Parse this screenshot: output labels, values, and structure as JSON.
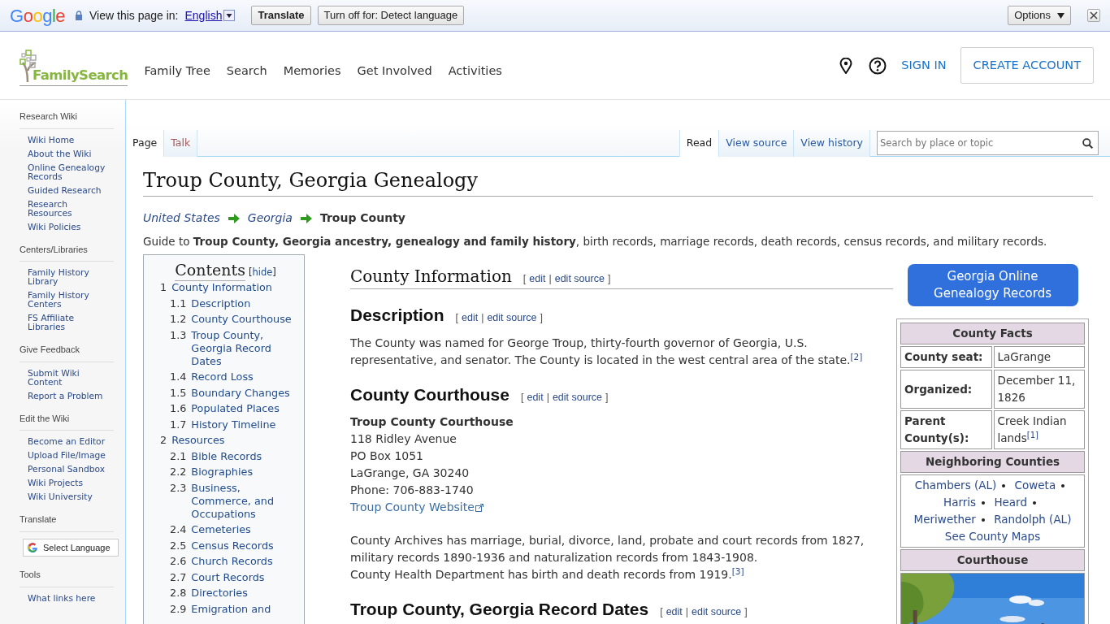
{
  "translate_bar": {
    "logo": "Google",
    "prompt": "View this page in:",
    "language": "English",
    "translate": "Translate",
    "turn_off": "Turn off for: Detect language",
    "options": "Options"
  },
  "header": {
    "logo_text": "FamilySearch",
    "nav": [
      "Family Tree",
      "Search",
      "Memories",
      "Get Involved",
      "Activities"
    ],
    "sign_in": "SIGN IN",
    "create_account": "CREATE ACCOUNT"
  },
  "sidebar": {
    "sections": [
      {
        "heading": "Research Wiki",
        "items": [
          "Wiki Home",
          "About the Wiki",
          "Online Genealogy Records",
          "Guided Research",
          "Research Resources",
          "Wiki Policies"
        ]
      },
      {
        "heading": "Centers/Libraries",
        "items": [
          "Family History Library",
          "Family History Centers",
          "FS Affiliate Libraries"
        ]
      },
      {
        "heading": "Give Feedback",
        "items": [
          "Submit Wiki Content",
          "Report a Problem"
        ]
      },
      {
        "heading": "Edit the Wiki",
        "items": [
          "Become an Editor",
          "Upload File/Image",
          "Personal Sandbox",
          "Wiki Projects",
          "Wiki University"
        ]
      },
      {
        "heading": "Translate",
        "widget": "Select Language"
      },
      {
        "heading": "Tools",
        "items": [
          "What links here"
        ]
      }
    ]
  },
  "page_tabs": {
    "left": [
      {
        "label": "Page",
        "selected": true
      },
      {
        "label": "Talk",
        "selected": false
      }
    ],
    "right": [
      {
        "label": "Read",
        "selected": true
      },
      {
        "label": "View source",
        "selected": false
      },
      {
        "label": "View history",
        "selected": false
      }
    ],
    "search": {
      "placeholder": "Search by place or topic"
    }
  },
  "title": "Troup County, Georgia Genealogy",
  "breadcrumb": [
    {
      "label": "United States",
      "kind": "link"
    },
    {
      "label": "Georgia",
      "kind": "link"
    },
    {
      "label": "Troup County",
      "kind": "current"
    }
  ],
  "intro": "Guide to **Troup County, Georgia ancestry, genealogy and family history**, birth records, marriage records, death records, census records, and military records.",
  "toc": {
    "title": "Contents",
    "hide": {
      "open": "[",
      "label": "hide",
      "close": "]"
    },
    "items": [
      {
        "number": "1",
        "label": "County Information",
        "children": [
          {
            "number": "1.1",
            "label": "Description"
          },
          {
            "number": "1.2",
            "label": "County Courthouse"
          },
          {
            "number": "1.3",
            "label": "Troup County, Georgia Record Dates"
          },
          {
            "number": "1.4",
            "label": "Record Loss"
          },
          {
            "number": "1.5",
            "label": "Boundary Changes"
          },
          {
            "number": "1.6",
            "label": "Populated Places"
          },
          {
            "number": "1.7",
            "label": "History Timeline"
          }
        ]
      },
      {
        "number": "2",
        "label": "Resources",
        "children": [
          {
            "number": "2.1",
            "label": "Bible Records"
          },
          {
            "number": "2.2",
            "label": "Biographies"
          },
          {
            "number": "2.3",
            "label": "Business, Commerce, and Occupations"
          },
          {
            "number": "2.4",
            "label": "Cemeteries"
          },
          {
            "number": "2.5",
            "label": "Census Records"
          },
          {
            "number": "2.6",
            "label": "Church Records"
          },
          {
            "number": "2.7",
            "label": "Court Records"
          },
          {
            "number": "2.8",
            "label": "Directories"
          },
          {
            "number": "2.9",
            "label": "Emigration and"
          }
        ]
      }
    ]
  },
  "blocks": [
    {
      "kind": "major",
      "text": "County Information",
      "edit": {
        "open": "[",
        "links": [
          "edit",
          "edit source"
        ],
        "separator": "|",
        "close": "]"
      }
    },
    {
      "kind": "minor",
      "text": "Description",
      "edit": {
        "open": "[",
        "links": [
          "edit",
          "edit source"
        ],
        "separator": "|",
        "close": "]"
      }
    },
    {
      "kind": "paragraph",
      "text": "The County was named for George Troup, thirty-fourth governor of Georgia, U.S. representative, and senator. The County is located in the west central area of the state.$^{[2]}$"
    },
    {
      "kind": "minor",
      "text": "County Courthouse",
      "edit": {
        "open": "[",
        "links": [
          "edit",
          "edit source"
        ],
        "separator": "|",
        "close": "]"
      }
    },
    {
      "kind": "address",
      "name": "Troup County Courthouse",
      "lines": [
        "118 Ridley Avenue",
        "PO Box 1051",
        "LaGrange, GA 30240",
        "Phone: 706-883-1740"
      ],
      "link": "Troup County Website"
    },
    {
      "kind": "paragraph",
      "text": "County Archives has marriage, burial, divorce, land, probate and court records from 1827, military records 1890-1936 and naturalization records from 1843-1908."
    },
    {
      "kind": "line",
      "text": "County Health Department has birth and death records from 1919.$^{[3]}$"
    },
    {
      "kind": "minor",
      "text": "Troup County, Georgia Record Dates",
      "edit": {
        "open": "[",
        "links": [
          "edit",
          "edit source"
        ],
        "separator": "|",
        "close": "]"
      }
    }
  ],
  "infobox": {
    "button": "Georgia Online Genealogy Records",
    "facts_title": "County Facts",
    "facts": [
      {
        "label": "County seat:",
        "value": "LaGrange"
      },
      {
        "label": "Organized:",
        "value": "December 11, 1826"
      },
      {
        "label": "Parent County(s):",
        "value": "Creek Indian lands$^{[1]}$"
      }
    ],
    "neighbors_title": "Neighboring Counties",
    "neighbors": [
      "Chambers (AL)",
      "Coweta",
      "Harris",
      "Heard",
      "Meriwether",
      "Randolph (AL)"
    ],
    "maps_link": "See County Maps",
    "courthouse_title": "Courthouse",
    "photo": {
      "kind": "picture"
    }
  }
}
